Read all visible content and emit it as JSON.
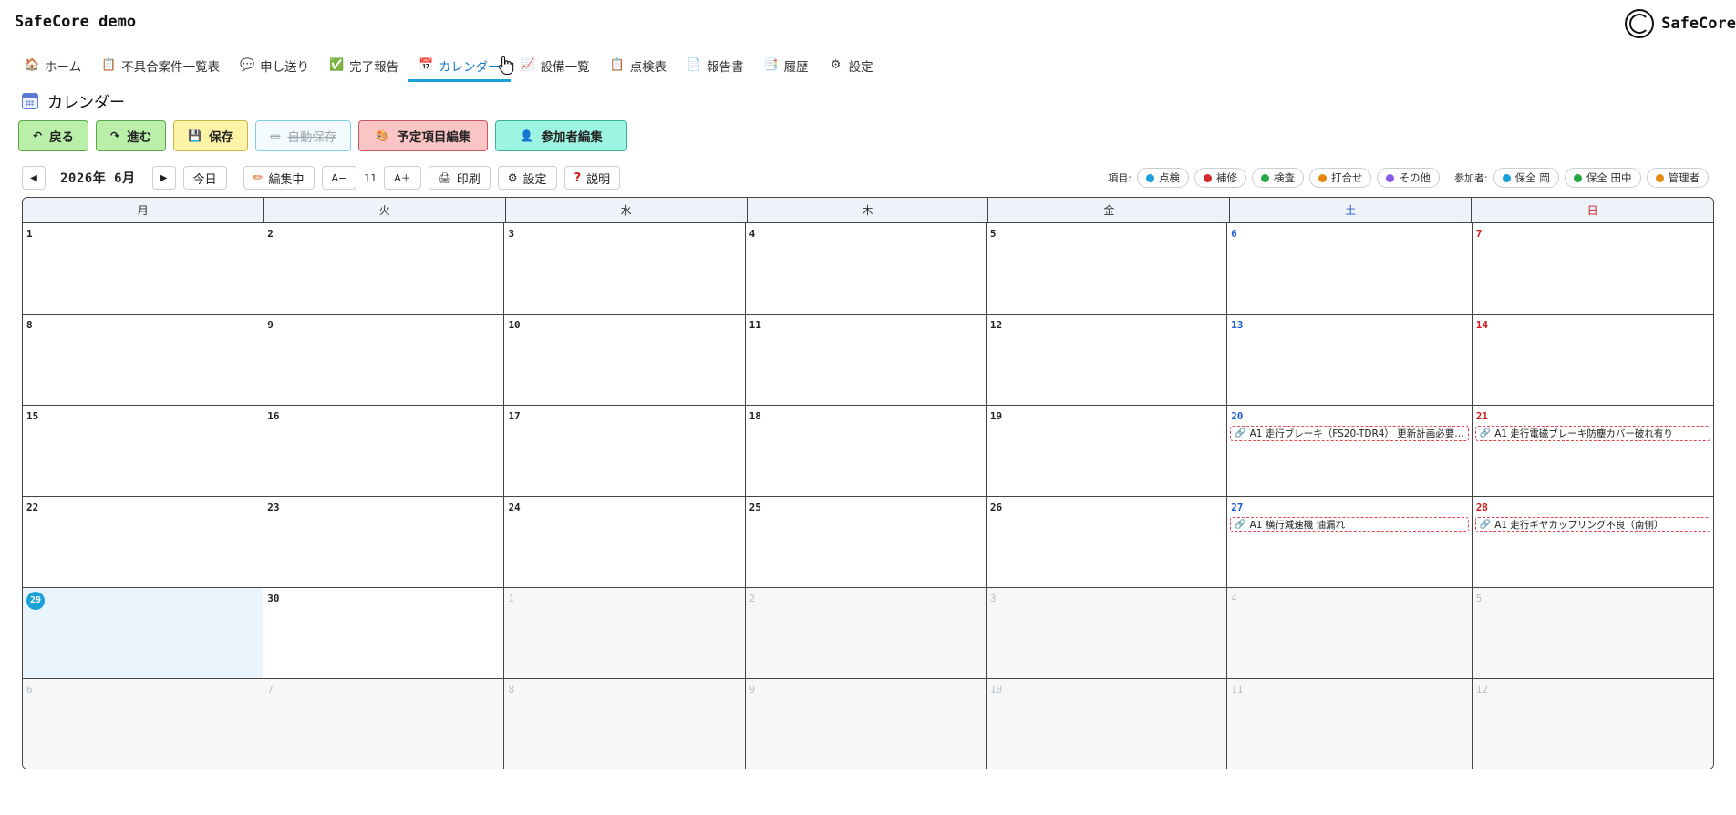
{
  "app": {
    "title": "SafeCore demo",
    "brand": "SafeCore",
    "logo_text": "SafeCore"
  },
  "nav": {
    "items": [
      {
        "label": "ホーム",
        "icon": "🏠"
      },
      {
        "label": "不具合案件一覧表",
        "icon": "📋"
      },
      {
        "label": "申し送り",
        "icon": "💬"
      },
      {
        "label": "完了報告",
        "icon": "✅"
      },
      {
        "label": "カレンダー",
        "icon": "📅",
        "active": true
      },
      {
        "label": "設備一覧",
        "icon": "📈"
      },
      {
        "label": "点検表",
        "icon": "📋"
      },
      {
        "label": "報告書",
        "icon": "📄"
      },
      {
        "label": "履歴",
        "icon": "📑"
      },
      {
        "label": "設定",
        "icon": "⚙"
      }
    ]
  },
  "page": {
    "title": "カレンダー"
  },
  "actions": {
    "back": "戻る",
    "forward": "進む",
    "save": "保存",
    "autosave": "自動保存",
    "edit_items": "予定項目編集",
    "edit_participants": "参加者編集"
  },
  "toolbar": {
    "prev": "◀",
    "month": "2026年 6月",
    "next": "▶",
    "today": "今日",
    "editing": "編集中",
    "font_down": "A−",
    "font_size": "11",
    "font_up": "A＋",
    "print": "印刷",
    "settings": "設定",
    "help": "説明"
  },
  "legend": {
    "items_label": "項目:",
    "items": [
      {
        "label": "点検",
        "color": "#1ba1d8"
      },
      {
        "label": "補修",
        "color": "#d42a2a"
      },
      {
        "label": "検査",
        "color": "#28a745"
      },
      {
        "label": "打合せ",
        "color": "#e58a0e"
      },
      {
        "label": "その他",
        "color": "#8b5be8"
      }
    ],
    "participants_label": "参加者:",
    "participants": [
      {
        "label": "保全 岡",
        "color": "#1ba1d8"
      },
      {
        "label": "保全 田中",
        "color": "#28a745"
      },
      {
        "label": "管理者",
        "color": "#e58a0e"
      }
    ]
  },
  "calendar": {
    "weekdays": [
      "月",
      "火",
      "水",
      "木",
      "金",
      "土",
      "日"
    ],
    "days": [
      {
        "d": "1"
      },
      {
        "d": "2"
      },
      {
        "d": "3"
      },
      {
        "d": "4"
      },
      {
        "d": "5"
      },
      {
        "d": "6"
      },
      {
        "d": "7"
      },
      {
        "d": "8"
      },
      {
        "d": "9"
      },
      {
        "d": "10"
      },
      {
        "d": "11"
      },
      {
        "d": "12"
      },
      {
        "d": "13"
      },
      {
        "d": "14"
      },
      {
        "d": "15"
      },
      {
        "d": "16"
      },
      {
        "d": "17"
      },
      {
        "d": "18"
      },
      {
        "d": "19"
      },
      {
        "d": "20",
        "events": [
          "A1 走行ブレーキ（FS20-TDR4） 更新計画必要…"
        ]
      },
      {
        "d": "21",
        "events": [
          "A1 走行電磁ブレーキ防塵カバー破れ有り"
        ]
      },
      {
        "d": "22"
      },
      {
        "d": "23"
      },
      {
        "d": "24"
      },
      {
        "d": "25"
      },
      {
        "d": "26"
      },
      {
        "d": "27",
        "events": [
          "A1 横行減速機 油漏れ"
        ]
      },
      {
        "d": "28",
        "events": [
          "A1 走行ギヤカップリング不良（南側）"
        ]
      },
      {
        "d": "29",
        "today": true
      },
      {
        "d": "30"
      },
      {
        "d": "1",
        "other": true
      },
      {
        "d": "2",
        "other": true
      },
      {
        "d": "3",
        "other": true
      },
      {
        "d": "4",
        "other": true
      },
      {
        "d": "5",
        "other": true
      },
      {
        "d": "6",
        "other": true
      },
      {
        "d": "7",
        "other": true
      },
      {
        "d": "8",
        "other": true
      },
      {
        "d": "9",
        "other": true
      },
      {
        "d": "10",
        "other": true
      },
      {
        "d": "11",
        "other": true
      },
      {
        "d": "12",
        "other": true
      }
    ]
  }
}
